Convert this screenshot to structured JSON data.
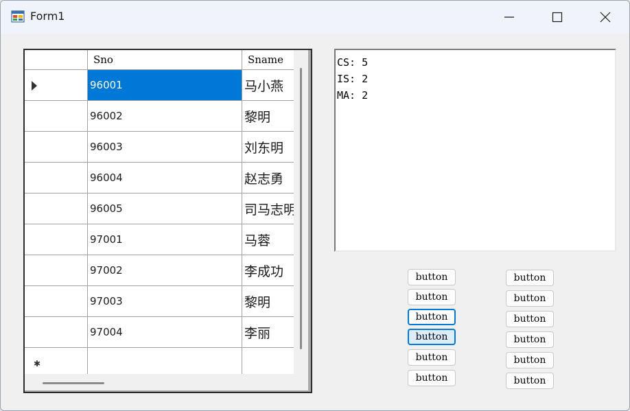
{
  "window": {
    "title": "Form1"
  },
  "grid": {
    "columns": [
      "Sno",
      "Sname"
    ],
    "rows": [
      {
        "sno": "96001",
        "sname": "马小燕"
      },
      {
        "sno": "96002",
        "sname": "黎明"
      },
      {
        "sno": "96003",
        "sname": "刘东明"
      },
      {
        "sno": "96004",
        "sname": "赵志勇"
      },
      {
        "sno": "96005",
        "sname": "司马志明"
      },
      {
        "sno": "97001",
        "sname": "马蓉"
      },
      {
        "sno": "97002",
        "sname": "李成功"
      },
      {
        "sno": "97003",
        "sname": "黎明"
      },
      {
        "sno": "97004",
        "sname": "李丽"
      }
    ],
    "selected_row": 0,
    "selection_color": "#0078d7"
  },
  "output": {
    "lines": [
      "CS: 5",
      "IS: 2",
      "MA: 2"
    ]
  },
  "buttons": {
    "left": [
      "button",
      "button",
      "button",
      "button",
      "button",
      "button"
    ],
    "right": [
      "button",
      "button",
      "button",
      "button",
      "button",
      "button"
    ]
  },
  "icons": {
    "app": "form-app-icon",
    "minimize": "minimize-icon",
    "maximize": "maximize-icon",
    "close": "close-icon"
  }
}
